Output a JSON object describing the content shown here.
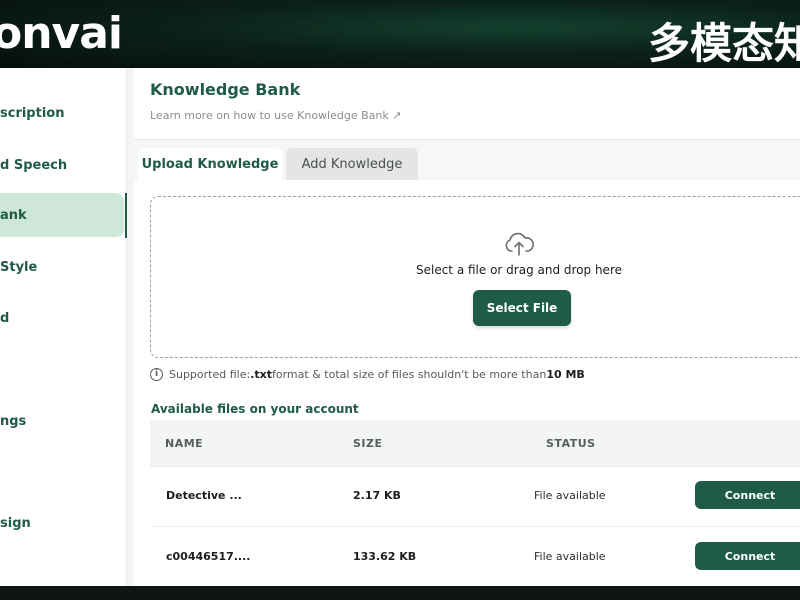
{
  "banner": {
    "logo_text": "onvai",
    "cjk_text": "多模态知"
  },
  "sidebar": {
    "items": [
      {
        "label": "scription",
        "active": false
      },
      {
        "label": "d Speech",
        "active": false
      },
      {
        "label": "ank",
        "active": true
      },
      {
        "label": "Style",
        "active": false
      },
      {
        "label": "d",
        "active": false
      },
      {
        "label": "",
        "active": false
      },
      {
        "label": "ngs",
        "active": false
      },
      {
        "label": "",
        "active": false
      },
      {
        "label": "sign",
        "active": false
      }
    ]
  },
  "header": {
    "title": "Knowledge Bank",
    "learn_link": "Learn more on how to use Knowledge Bank ↗"
  },
  "tabs": [
    {
      "label": "Upload Knowledge",
      "active": true
    },
    {
      "label": "Add Knowledge",
      "active": false
    }
  ],
  "upload": {
    "drop_text": "Select a file or drag and drop here",
    "select_button": "Select File",
    "info_prefix": "Supported file: ",
    "info_ext": ".txt",
    "info_middle": " format & total size of files shouldn't be more than ",
    "info_size": "10 MB"
  },
  "files": {
    "title": "Available files on your account",
    "columns": [
      "NAME",
      "SIZE",
      "STATUS"
    ],
    "rows": [
      {
        "name": "Detective ...",
        "size": "2.17 KB",
        "status": "File available",
        "action": "Connect"
      },
      {
        "name": "c00446517....",
        "size": "133.62 KB",
        "status": "File available",
        "action": "Connect"
      }
    ]
  },
  "colors": {
    "accent": "#1f5c45",
    "active_item_bg": "#cfe7d8"
  }
}
